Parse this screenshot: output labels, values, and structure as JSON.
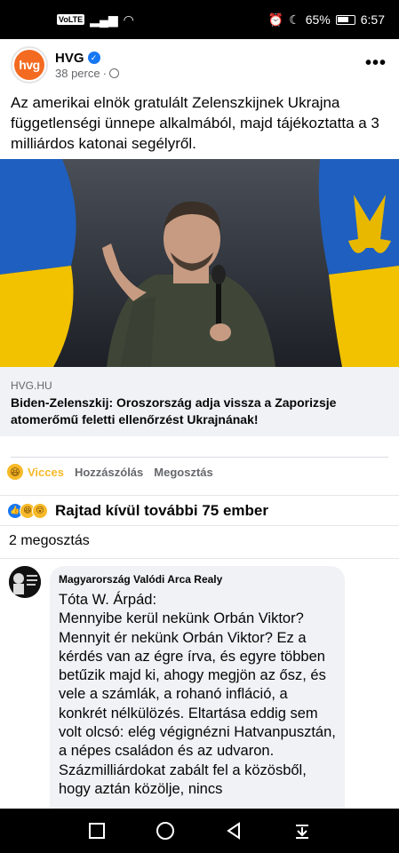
{
  "status_bar": {
    "carrier": "VoLTE",
    "battery": "65%",
    "time": "6:57"
  },
  "post": {
    "page_name": "HVG",
    "avatar_text": "hvg",
    "time": "38 perce",
    "text": "Az amerikai elnök gratulált Zelenszkijnek Ukrajna függetlenségi ünnepe alkalmából, majd tájékoztatta a 3 milliárdos katonai segélyről."
  },
  "link_preview": {
    "domain": "HVG.HU",
    "title": "Biden-Zelenszkij: Oroszország adja vissza a Zaporizsje atomerőmű feletti ellenőrzést Ukrajnának!"
  },
  "actions": {
    "react": "Vicces",
    "comment": "Hozzászólás",
    "share": "Megosztás"
  },
  "reactions": {
    "text": "Rajtad kívül további 75 ember"
  },
  "shares": "2 megosztás",
  "comment": {
    "author": "Magyarország Valódi Arca Realy",
    "avatar_text": "Magyarország Valódi Arca",
    "text": "Tóta W. Árpád:\nMennyibe kerül nekünk Orbán Viktor? Mennyit ér nekünk Orbán Viktor? Ez a kérdés van az égre írva, és egyre többen betűzik majd ki, ahogy megjön az ősz, és vele a számlák, a rohanó infláció, a konkrét nélkülözés. Eltartása eddig sem volt olcsó: elég végignézni Hatvanpusztán, a népes családon és az udvaron. Százmilliárdokat zabált fel a közösből, hogy aztán közölje, nincs"
  }
}
